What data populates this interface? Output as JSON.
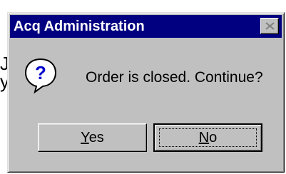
{
  "background": {
    "partial_text_line1": "J",
    "partial_text_line2": "yc"
  },
  "dialog": {
    "title": "Acq Administration",
    "close_icon": "close-icon",
    "message_icon": "question-icon",
    "message": "Order is closed. Continue?",
    "buttons": [
      {
        "mnemonic": "Y",
        "rest": "es",
        "label": "Yes"
      },
      {
        "mnemonic": "N",
        "rest": "o",
        "label": "No",
        "default": true
      }
    ]
  },
  "colors": {
    "title_bar": "#000080",
    "dialog_face": "#c0c0c0",
    "question_icon": "#0000cc"
  }
}
